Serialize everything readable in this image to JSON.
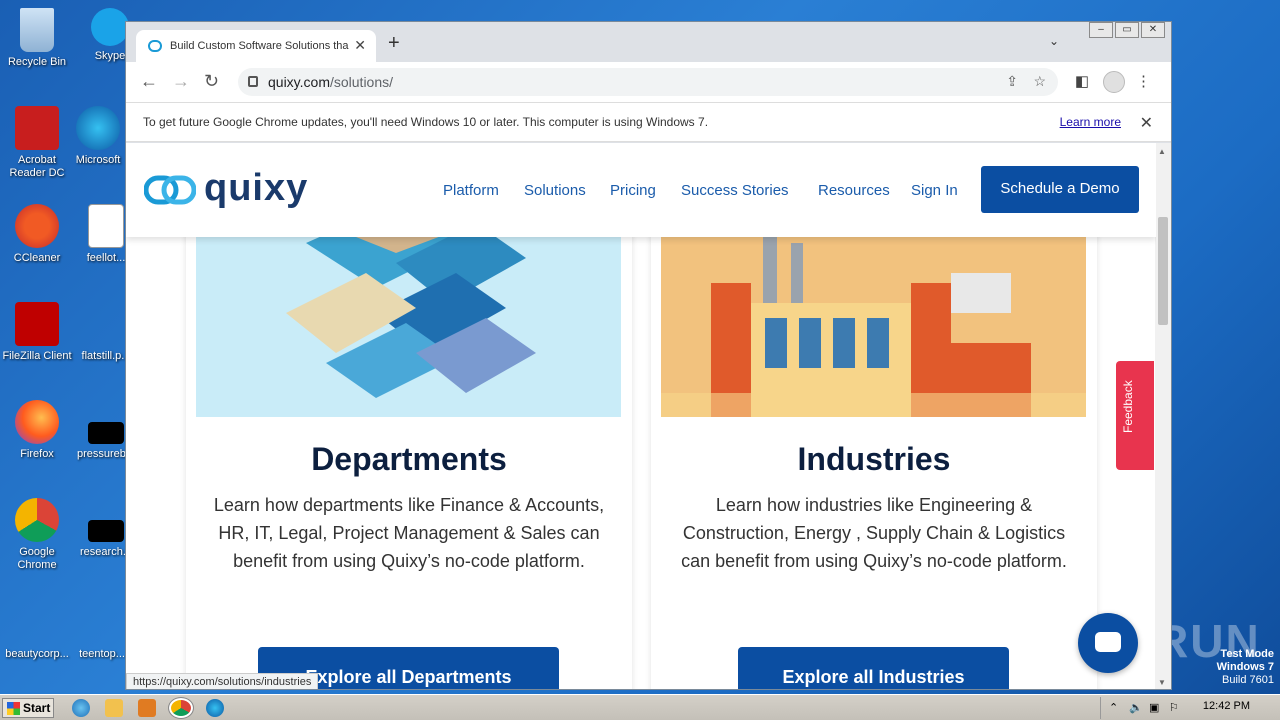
{
  "desktop": {
    "icons": [
      {
        "label": "Recycle Bin",
        "name": "recycle-bin-icon"
      },
      {
        "label": "Skype",
        "name": "skype-icon"
      },
      {
        "label": "Acrobat Reader DC",
        "name": "acrobat-icon"
      },
      {
        "label": "Microsoft",
        "name": "edge-icon"
      },
      {
        "label": "CCleaner",
        "name": "ccleaner-icon"
      },
      {
        "label": "feellot...",
        "name": "word-doc-icon"
      },
      {
        "label": "FileZilla Client",
        "name": "filezilla-icon"
      },
      {
        "label": "flatstill.p...",
        "name": "file-icon"
      },
      {
        "label": "Firefox",
        "name": "firefox-icon"
      },
      {
        "label": "pressureb...",
        "name": "file-icon"
      },
      {
        "label": "Google Chrome",
        "name": "chrome-icon"
      },
      {
        "label": "research...",
        "name": "file-icon"
      },
      {
        "label": "beautycorp...",
        "name": "file-icon"
      },
      {
        "label": "teentop...",
        "name": "file-icon"
      }
    ]
  },
  "browser": {
    "tab_title": "Build Custom Software Solutions tha",
    "url_host": "quixy.com",
    "url_path": "/solutions/",
    "infobar_text": "To get future Google Chrome updates, you'll need Windows 10 or later. This computer is using Windows 7.",
    "infobar_link": "Learn more",
    "status_url": "https://quixy.com/solutions/industries"
  },
  "site": {
    "logo_text": "quixy",
    "nav": [
      "Platform",
      "Solutions",
      "Pricing",
      "Success Stories",
      "Resources",
      "Sign In"
    ],
    "cta": "Schedule a Demo",
    "cards": [
      {
        "title": "Departments",
        "body": "Learn how departments like Finance & Accounts, HR, IT, Legal, Project Management & Sales can benefit from using Quixy’s no-code platform.",
        "button": "Explore all Departments"
      },
      {
        "title": "Industries",
        "body": "Learn how industries like Engineering & Construction, Energy , Supply Chain & Logistics can benefit from using Quixy’s no-code platform.",
        "button": "Explore all Industries"
      }
    ],
    "feedback": "Feedback"
  },
  "taskbar": {
    "start": "Start",
    "clock": "12:42 PM"
  },
  "watermark": {
    "line1": "Test Mode",
    "line2": "Windows 7",
    "line3": "Build 7601",
    "brand": "ANY RUN"
  }
}
